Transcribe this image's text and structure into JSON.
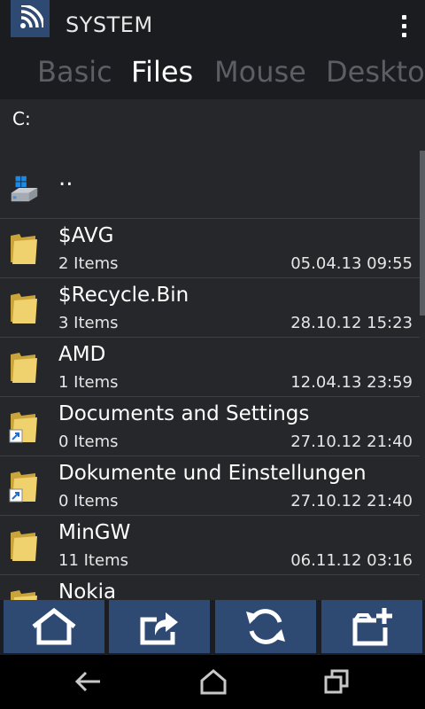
{
  "header": {
    "title": "SYSTEM",
    "app_icon": "wifi-signal-icon",
    "menu_icon": "overflow-menu-icon"
  },
  "tabs": [
    {
      "label": "Basic",
      "active": false
    },
    {
      "label": "Files",
      "active": true
    },
    {
      "label": "Mouse",
      "active": false
    },
    {
      "label": "Desktop",
      "active": false
    }
  ],
  "path": "C:",
  "parent": {
    "label": "..",
    "icon": "drive-icon"
  },
  "files": [
    {
      "name": "$AVG",
      "count": "2 Items",
      "date": "05.04.13 09:55",
      "icon": "folder-icon"
    },
    {
      "name": "$Recycle.Bin",
      "count": "3 Items",
      "date": "28.10.12 15:23",
      "icon": "folder-icon"
    },
    {
      "name": "AMD",
      "count": "1 Items",
      "date": "12.04.13 23:59",
      "icon": "folder-icon"
    },
    {
      "name": "Documents and Settings",
      "count": "0 Items",
      "date": "27.10.12 21:40",
      "icon": "folder-shortcut-icon"
    },
    {
      "name": "Dokumente und Einstellungen",
      "count": "0 Items",
      "date": "27.10.12 21:40",
      "icon": "folder-shortcut-icon"
    },
    {
      "name": "MinGW",
      "count": "11 Items",
      "date": "06.11.12 03:16",
      "icon": "folder-icon"
    },
    {
      "name": "Nokia",
      "count": "",
      "date": "",
      "icon": "folder-icon"
    }
  ],
  "toolbar": [
    {
      "icon": "home-icon"
    },
    {
      "icon": "share-upload-icon"
    },
    {
      "icon": "refresh-icon"
    },
    {
      "icon": "new-folder-icon"
    }
  ],
  "nav": [
    {
      "icon": "back-icon"
    },
    {
      "icon": "home-nav-icon"
    },
    {
      "icon": "recent-apps-icon"
    }
  ],
  "colors": {
    "accent": "#2f4a72",
    "folder": "#e8c85a",
    "background": "#25272b"
  }
}
